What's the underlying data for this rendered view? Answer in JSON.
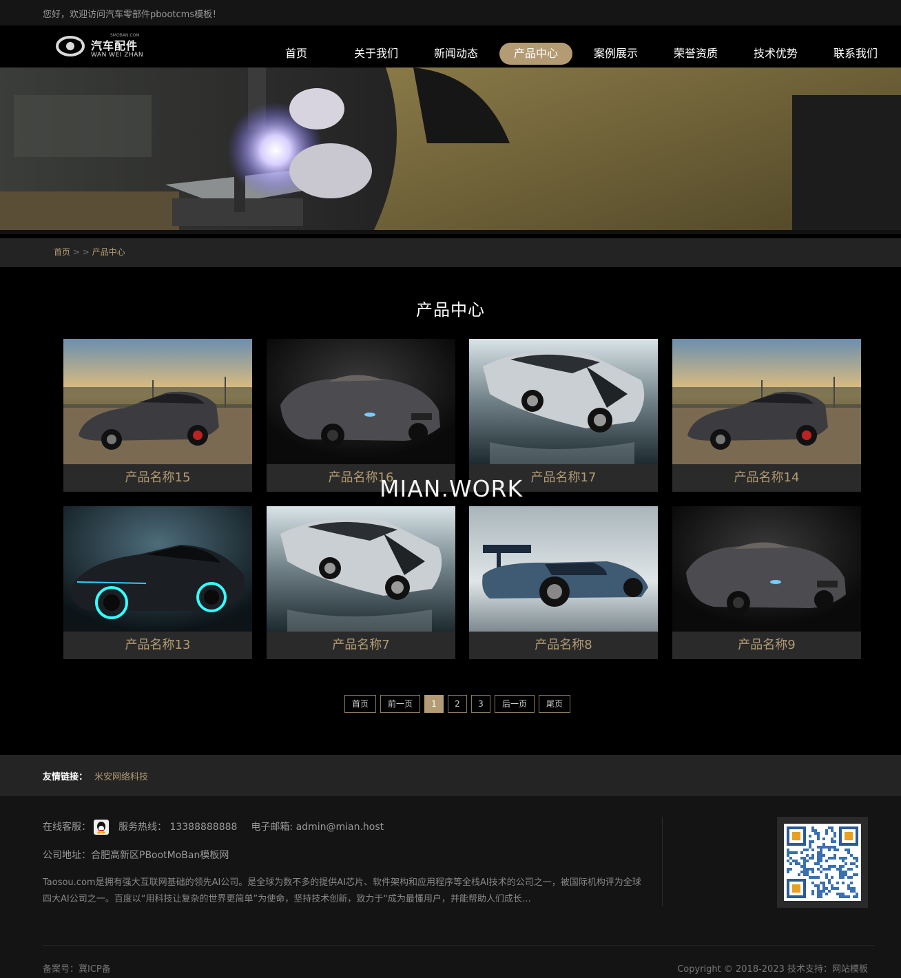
{
  "topbar": {
    "welcome": "您好，欢迎访问汽车零部件pbootcms模板！"
  },
  "logo": {
    "cn": "汽车配件",
    "en": "WAN WEI ZHAN",
    "tiny": "SMOBAN.COM"
  },
  "nav": {
    "items": [
      {
        "label": "首页"
      },
      {
        "label": "关于我们"
      },
      {
        "label": "新闻动态"
      },
      {
        "label": "产品中心",
        "active": true
      },
      {
        "label": "案例展示"
      },
      {
        "label": "荣誉资质"
      },
      {
        "label": "技术优势"
      },
      {
        "label": "联系我们"
      }
    ]
  },
  "breadcrumb": {
    "home": "首页",
    "sep": " > > ",
    "current": "产品中心"
  },
  "section": {
    "title": "产品中心"
  },
  "products": [
    {
      "name": "产品名称15",
      "image": "grey-sports-car-sunset"
    },
    {
      "name": "产品名称16",
      "image": "dark-concept-roadster"
    },
    {
      "name": "产品名称17",
      "image": "silver-supercar"
    },
    {
      "name": "产品名称14",
      "image": "grey-sports-car-sunset"
    },
    {
      "name": "产品名称13",
      "image": "neon-blue-supercar"
    },
    {
      "name": "产品名称7",
      "image": "silver-supercar"
    },
    {
      "name": "产品名称8",
      "image": "race-car-rear-wing"
    },
    {
      "name": "产品名称9",
      "image": "dark-concept-roadster"
    }
  ],
  "watermark": "MIAN.WORK",
  "pagination": {
    "first": "首页",
    "prev": "前一页",
    "pages": [
      "1",
      "2",
      "3"
    ],
    "current": "1",
    "next": "后一页",
    "last": "尾页"
  },
  "links": {
    "label": "友情链接：",
    "items": [
      "米安网络科技"
    ]
  },
  "footer": {
    "service_label": "在线客服：",
    "hotline": "服务热线： 13388888888",
    "email": "电子邮箱: admin@mian.host",
    "address": "公司地址：合肥高新区PBootMoBan模板网",
    "description": "Taosou.com是拥有强大互联网基础的领先AI公司。是全球为数不多的提供AI芯片、软件架构和应用程序等全栈AI技术的公司之一，被国际机构评为全球四大AI公司之一。百度以“用科技让复杂的世界更简单”为使命，坚持技术创新，致力于“成为最懂用户，并能帮助人们成长…",
    "icp": "备案号：冀ICP备",
    "copyright": "Copyright © 2018-2023 技术支持：网站模板"
  },
  "colors": {
    "accent": "#b39b74",
    "background": "#000000",
    "panel": "#242424"
  }
}
